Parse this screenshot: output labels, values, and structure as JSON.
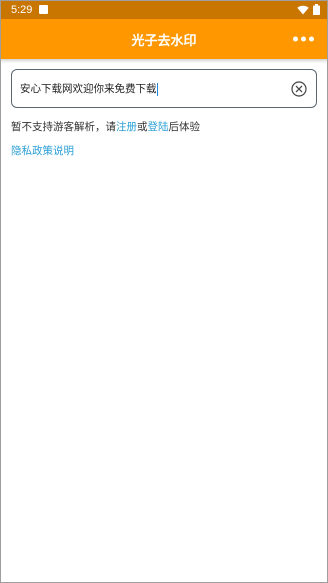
{
  "status_bar": {
    "time": "5:29",
    "icons": [
      "notification-square-icon",
      "wifi-icon",
      "battery-icon"
    ]
  },
  "app_bar": {
    "title": "光子去水印",
    "menu_icon": "more-dots-icon"
  },
  "url_input": {
    "value": "安心下载网欢迎你来免费下载",
    "clear_icon": "clear-circle-x-icon"
  },
  "notice": {
    "prefix": "暂不支持游客解析，请",
    "register_link": "注册",
    "middle": "或",
    "login_link": "登陆",
    "suffix": "后体验"
  },
  "privacy_link": "隐私政策说明",
  "colors": {
    "status_bar": "#c97600",
    "app_bar": "#ff9800",
    "link": "#2a9fd6"
  }
}
